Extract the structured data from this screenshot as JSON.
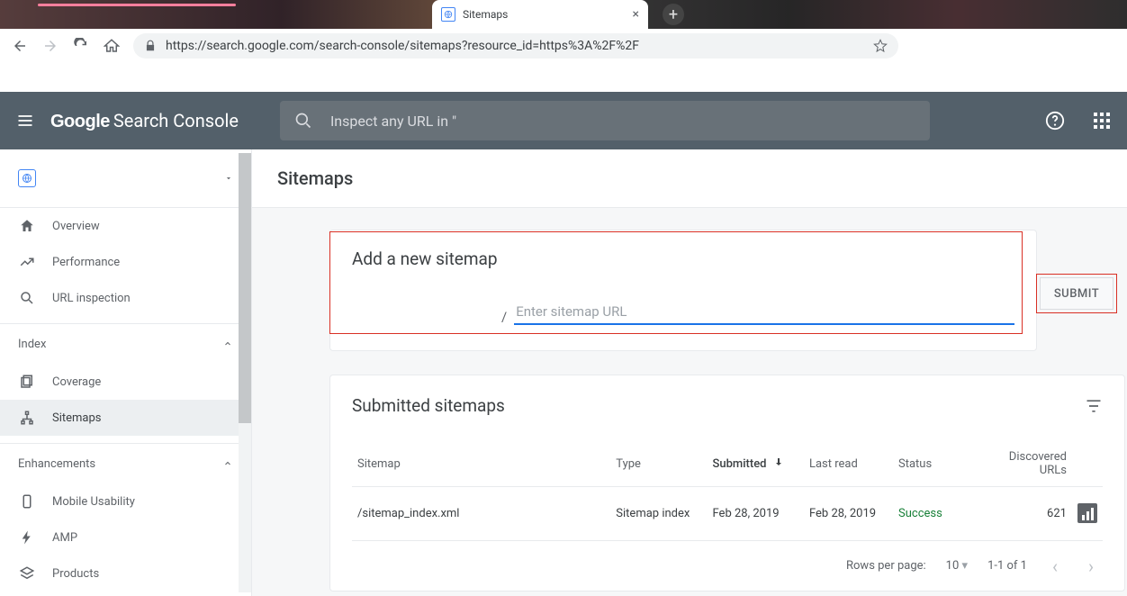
{
  "browser": {
    "tab_title": "Sitemaps",
    "url": "https://search.google.com/search-console/sitemaps?resource_id=https%3A%2F%2F"
  },
  "header": {
    "logo1": "Google",
    "logo2": "Search Console",
    "inspect_placeholder": "Inspect any URL in \""
  },
  "sidebar": {
    "overview": "Overview",
    "performance": "Performance",
    "url_inspection": "URL inspection",
    "index_head": "Index",
    "coverage": "Coverage",
    "sitemaps": "Sitemaps",
    "enhancements_head": "Enhancements",
    "mobile": "Mobile Usability",
    "amp": "AMP",
    "products": "Products"
  },
  "page": {
    "title": "Sitemaps",
    "add_title": "Add a new sitemap",
    "url_prefix_slash": "/",
    "sitemap_placeholder": "Enter sitemap URL",
    "submit": "SUBMIT",
    "submitted_title": "Submitted sitemaps",
    "columns": {
      "sitemap": "Sitemap",
      "type": "Type",
      "submitted": "Submitted",
      "last_read": "Last read",
      "status": "Status",
      "discovered": "Discovered URLs"
    },
    "rows": [
      {
        "sitemap": "/sitemap_index.xml",
        "type": "Sitemap index",
        "submitted": "Feb 28, 2019",
        "last_read": "Feb 28, 2019",
        "status": "Success",
        "discovered": "621"
      }
    ],
    "footer": {
      "rpp_label": "Rows per page:",
      "rpp_value": "10",
      "range": "1-1 of 1"
    }
  }
}
